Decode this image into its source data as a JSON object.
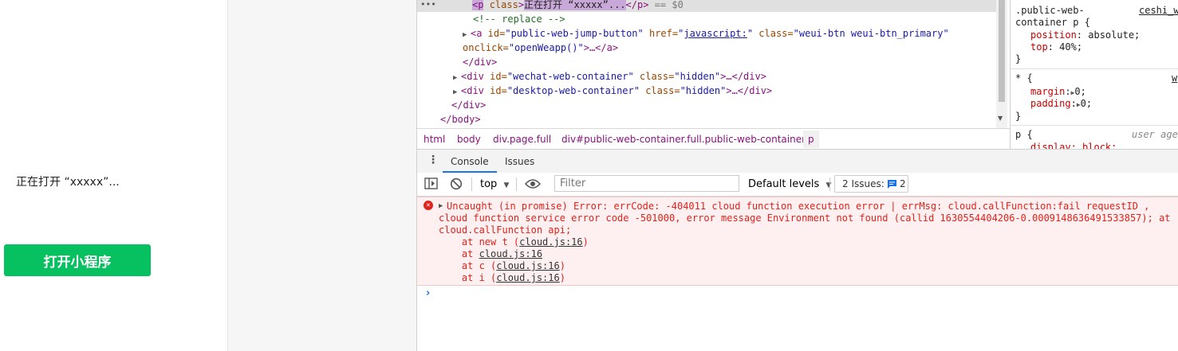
{
  "page": {
    "opening_text": "正在打开 “xxxxx”...",
    "open_button": "打开小程序"
  },
  "elements": {
    "selected_dots": "•••",
    "selected_tag_open": "<p",
    "selected_attr": "class",
    "selected_close_bracket": ">",
    "selected_text": "正在打开 “xxxxx”...",
    "selected_tag_close": "</p>",
    "selected_marker": "== $0",
    "comment": "<!-- replace -->",
    "a_open": "<a",
    "a_id_attr": " id=",
    "a_id_val": "\"public-web-jump-button\"",
    "a_href_attr": " href=",
    "a_href_q1": "\"",
    "a_href_val": "javascript:",
    "a_href_q2": "\"",
    "a_class_attr": " class=",
    "a_class_val": "\"weui-btn weui-btn_primary\"",
    "a_onclick_attr": "onclick=",
    "a_onclick_val": "\"openWeapp()\"",
    "a_rest": ">…</a>",
    "div_close": "</div>",
    "div2_open": "<div",
    "div2_id_attr": " id=",
    "div2_id_val": "\"wechat-web-container\"",
    "div2_class_attr": " class=",
    "div2_class_val": "\"hidden\"",
    "div2_rest": ">…</div>",
    "div3_open": "<div",
    "div3_id_attr": " id=",
    "div3_id_val": "\"desktop-web-container\"",
    "div3_class_attr": " class=",
    "div3_class_val": "\"hidden\"",
    "div3_rest": ">…</div>",
    "div_close2": "</div>",
    "body_close": "</body>"
  },
  "breadcrumb": [
    "html",
    "body",
    "div.page.full",
    "div#public-web-container.full.public-web-container",
    "p"
  ],
  "styles": {
    "rule1_selector_a": ".public-web-",
    "rule1_selector_b": "container p {",
    "rule1_source": "ceshi_w",
    "rule1_props": [
      {
        "name": "position",
        "value": "absolute;"
      },
      {
        "name": "top",
        "value": "40%;"
      }
    ],
    "close": "}",
    "rule2_selector": "* {",
    "rule2_source": "w",
    "rule2_props": [
      {
        "name": "margin",
        "value": "0;"
      },
      {
        "name": "padding",
        "value": "0;"
      }
    ],
    "rule3_selector": "p {",
    "rule3_source": "user age",
    "rule3_partial": "display: block;"
  },
  "drawer": {
    "tabs": [
      "Console",
      "Issues"
    ]
  },
  "toolbar": {
    "context": "top",
    "filter_placeholder": "Filter",
    "levels": "Default levels",
    "issues_label": "2 Issues:",
    "issues_count": "2"
  },
  "error": {
    "line1": "Uncaught (in promise) Error: errCode: -404011 cloud function execution error | errMsg: cloud.callFunction:fail requestID ,",
    "line2": "cloud function service error code -501000, error message Environment not found (callid 1630554404206-0.0009148636491533857); at",
    "line3": "cloud.callFunction api;",
    "stack": [
      {
        "prefix": "    at new t (",
        "link": "cloud.js:16",
        "suffix": ")"
      },
      {
        "prefix": "    at ",
        "link": "cloud.js:16",
        "suffix": ""
      },
      {
        "prefix": "    at c (",
        "link": "cloud.js:16",
        "suffix": ")"
      },
      {
        "prefix": "    at i (",
        "link": "cloud.js:16",
        "suffix": ")"
      }
    ]
  },
  "colors": {
    "primary_green": "#07c160",
    "error_red": "#e0231c",
    "error_bg": "#fef0f0",
    "tab_accent": "#1a73e8"
  }
}
